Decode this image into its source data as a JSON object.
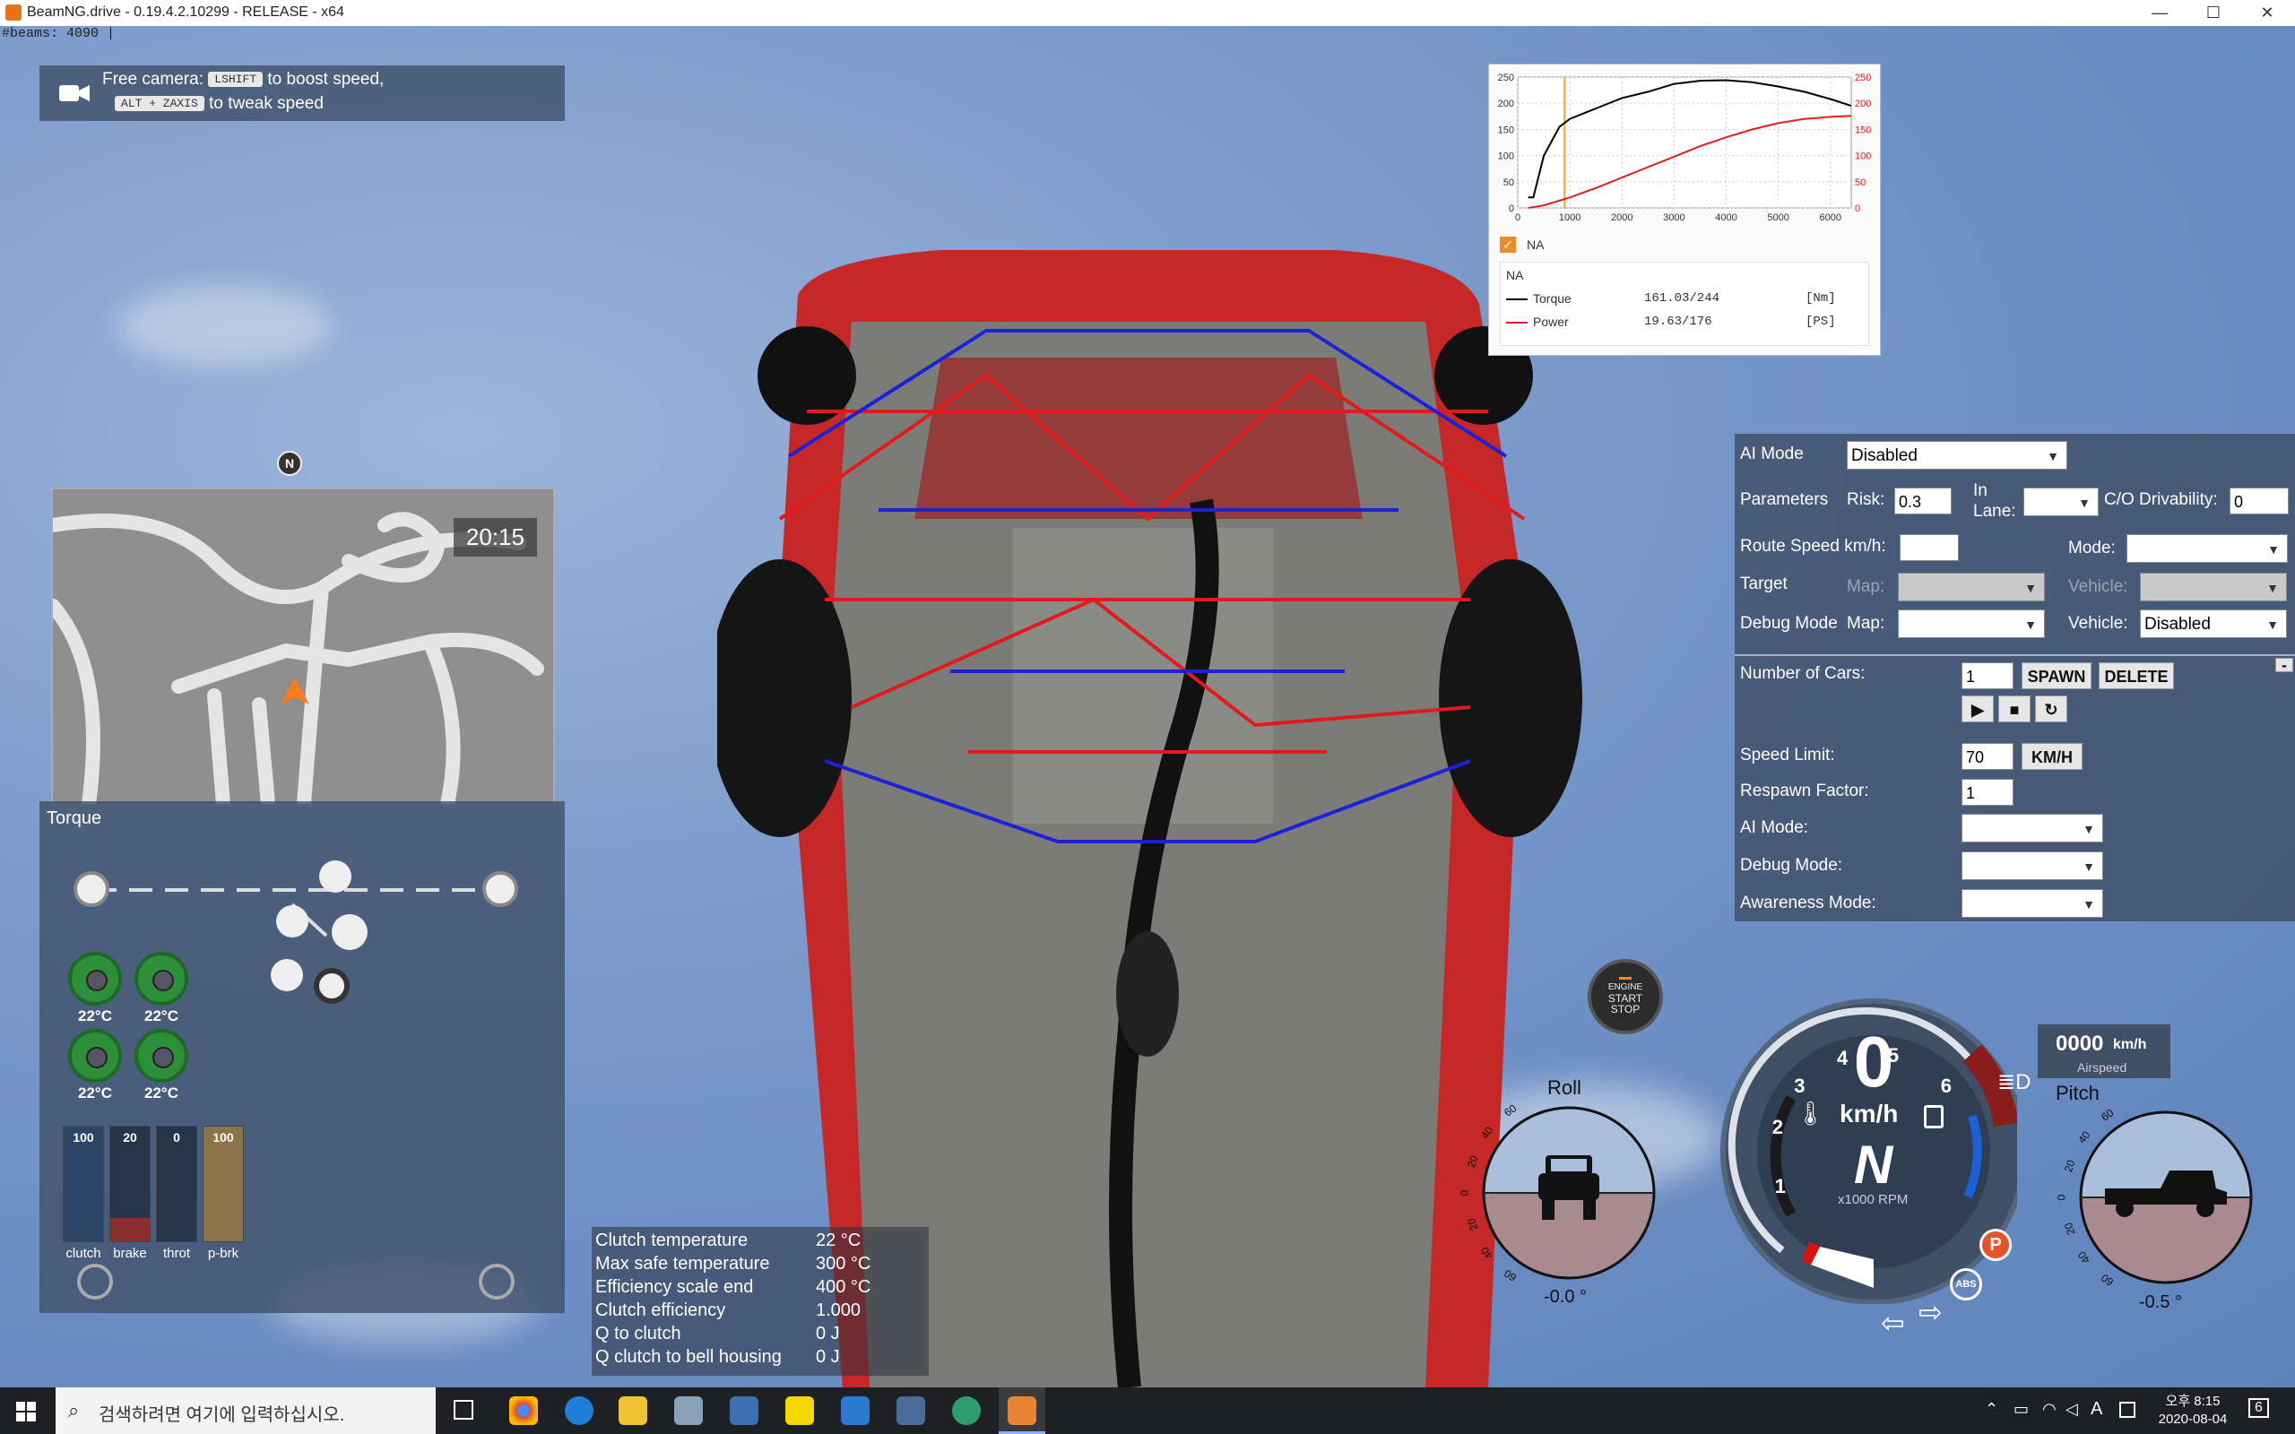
{
  "window": {
    "title": "BeamNG.drive - 0.19.4.2.10299 - RELEASE - x64",
    "minimize": "—",
    "maximize": "☐",
    "close": "✕"
  },
  "hud": {
    "beams_text": "#beams: 4090 |"
  },
  "camera_hint": {
    "line1_prefix": "Free camera:",
    "key1": "LSHIFT",
    "line1_suffix": "to boost speed,",
    "key2": "ALT + ZAXIS",
    "line2_suffix": "to tweak speed"
  },
  "minimap": {
    "compass": "N",
    "time": "20:15"
  },
  "torque_panel": {
    "title": "Torque",
    "brake_temps": [
      "22°C",
      "22°C",
      "22°C",
      "22°C"
    ],
    "pedals": [
      {
        "name": "clutch",
        "value": "100",
        "fill": 1.0,
        "color": "#2c4566"
      },
      {
        "name": "brake",
        "value": "20",
        "fill": 0.2,
        "color": "#8a2e2e"
      },
      {
        "name": "throt",
        "value": "0",
        "fill": 0.0,
        "color": "#2f6a3a"
      },
      {
        "name": "p-brk",
        "value": "100",
        "fill": 1.0,
        "color": "#8a7348"
      }
    ]
  },
  "clutch_info": {
    "rows": [
      {
        "label": "Clutch temperature",
        "value": "22 °C"
      },
      {
        "label": "Max safe temperature",
        "value": "300 °C"
      },
      {
        "label": "Efficiency scale end",
        "value": "400 °C"
      },
      {
        "label": "Clutch efficiency",
        "value": "1.000"
      },
      {
        "label": "Q to clutch",
        "value": "0 J"
      },
      {
        "label": "Q clutch to bell housing",
        "value": "0 J"
      }
    ]
  },
  "chart_data": {
    "type": "line",
    "title": "",
    "x_ticks": [
      "0",
      "1000",
      "2000",
      "3000",
      "4000",
      "5000",
      "6000"
    ],
    "y_left_ticks": [
      "0",
      "50",
      "100",
      "150",
      "200",
      "250"
    ],
    "y_right_ticks": [
      "0",
      "50",
      "100",
      "150",
      "200",
      "250"
    ],
    "xlim": [
      0,
      6400
    ],
    "ylim": [
      0,
      250
    ],
    "current_rpm": 900,
    "series": [
      {
        "name": "Torque",
        "color": "#000000",
        "x": [
          200,
          300,
          500,
          800,
          1000,
          1500,
          2000,
          2500,
          3000,
          3500,
          4000,
          4500,
          5000,
          5500,
          6000,
          6400
        ],
        "values": [
          20,
          20,
          100,
          155,
          170,
          190,
          210,
          222,
          237,
          243,
          244,
          240,
          232,
          222,
          208,
          195
        ]
      },
      {
        "name": "Power",
        "color": "#e02020",
        "x": [
          200,
          500,
          1000,
          1500,
          2000,
          2500,
          3000,
          3500,
          4000,
          4500,
          5000,
          5500,
          6000,
          6400
        ],
        "values": [
          0,
          5,
          20,
          38,
          58,
          78,
          98,
          118,
          135,
          150,
          162,
          170,
          174,
          176
        ]
      }
    ],
    "checkbox_label": "NA",
    "legend_header": "NA",
    "legend": [
      {
        "name": "Torque",
        "value": "161.03/244",
        "unit": "[Nm]",
        "color": "#000000"
      },
      {
        "name": "Power",
        "value": "19.63/176",
        "unit": "[PS]",
        "color": "#e02020"
      }
    ]
  },
  "ai_panel": {
    "ai_mode_label": "AI Mode",
    "ai_mode_value": "Disabled",
    "parameters_label": "Parameters",
    "risk_label": "Risk:",
    "risk_value": "0.3",
    "in_lane_label": "In Lane:",
    "co_label": "C/O Drivability:",
    "co_value": "0",
    "route_speed_label": "Route Speed km/h:",
    "mode_label": "Mode:",
    "target_label": "Target",
    "map_label": "Map:",
    "vehicle_label": "Vehicle:",
    "debug_mode_label": "Debug Mode",
    "debug_map_label": "Map:",
    "debug_vehicle_label": "Vehicle:",
    "debug_vehicle_value": "Disabled",
    "num_cars_label": "Number of Cars:",
    "num_cars_value": "1",
    "spawn_label": "SPAWN",
    "delete_label": "DELETE",
    "speed_limit_label": "Speed Limit:",
    "speed_limit_value": "70",
    "speed_unit_label": "KM/H",
    "respawn_label": "Respawn Factor:",
    "respawn_value": "1",
    "ai_mode2_label": "AI Mode:",
    "debug_mode2_label": "Debug Mode:",
    "awareness_label": "Awareness Mode:",
    "collapse": "-"
  },
  "engine_button": {
    "line1": "ENGINE",
    "line2": "START",
    "line3": "STOP"
  },
  "roll": {
    "title": "Roll",
    "value": "-0.0 °",
    "ticks": [
      "60",
      "40",
      "20",
      "0",
      "20",
      "40",
      "60"
    ]
  },
  "pitch": {
    "title": "Pitch",
    "value": "-0.5 °",
    "ticks": [
      "60",
      "40",
      "20",
      "0",
      "20",
      "40",
      "60"
    ]
  },
  "speedo": {
    "speed": "0",
    "unit": "km/h",
    "gear": "N",
    "rpm_unit": "x1000 RPM",
    "ticks": [
      "1",
      "2",
      "3",
      "4",
      "5",
      "6"
    ],
    "airspeed": "0000",
    "airspeed_unit": "km/h",
    "airspeed_label": "Airspeed",
    "park": "P",
    "abs": "ABS"
  },
  "taskbar": {
    "search_placeholder": "검색하려면 여기에 입력하십시오.",
    "time": "오후 8:15",
    "date": "2020-08-04",
    "lang": "A",
    "notif": "6"
  }
}
